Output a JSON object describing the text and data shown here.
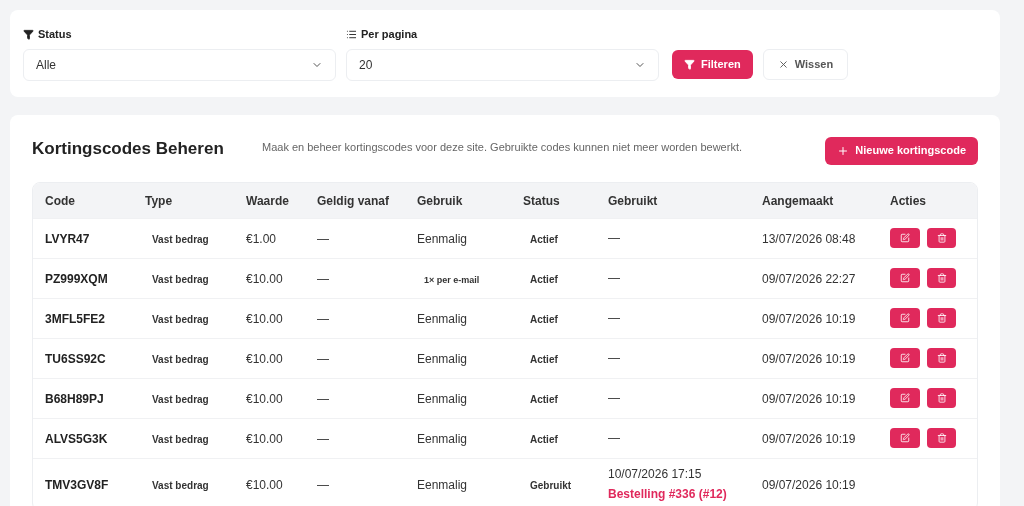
{
  "filters": {
    "status": {
      "label": "Status",
      "value": "Alle"
    },
    "per_page": {
      "label": "Per pagina",
      "value": "20"
    },
    "buttons": {
      "filter": "Filteren",
      "clear": "Wissen"
    }
  },
  "panel": {
    "title": "Kortingscodes Beheren",
    "description": "Maak en beheer kortingscodes voor deze site. Gebruikte codes kunnen niet meer worden bewerkt.",
    "new_button": "Nieuwe kortingscode"
  },
  "table": {
    "columns": [
      "Code",
      "Type",
      "Waarde",
      "Geldig vanaf",
      "Gebruik",
      "Status",
      "Gebruikt",
      "Aangemaakt",
      "Acties"
    ],
    "rows": [
      {
        "code": "LVYR47",
        "type": "Vast bedrag",
        "value": "€1.00",
        "valid_from": "—",
        "usage": "Eenmalig",
        "kind": "plain",
        "status": "Actief",
        "used": "—",
        "created": "13/07/2026 08:48",
        "editable": true
      },
      {
        "code": "PZ999XQM",
        "type": "Vast bedrag",
        "value": "€10.00",
        "valid_from": "—",
        "usage": "1× per e-mail",
        "kind": "badge",
        "status": "Actief",
        "used": "—",
        "created": "09/07/2026 22:27",
        "editable": true
      },
      {
        "code": "3MFL5FE2",
        "type": "Vast bedrag",
        "value": "€10.00",
        "valid_from": "—",
        "usage": "Eenmalig",
        "kind": "plain",
        "status": "Actief",
        "used": "—",
        "created": "09/07/2026 10:19",
        "editable": true
      },
      {
        "code": "TU6SS92C",
        "type": "Vast bedrag",
        "value": "€10.00",
        "valid_from": "—",
        "usage": "Eenmalig",
        "kind": "plain",
        "status": "Actief",
        "used": "—",
        "created": "09/07/2026 10:19",
        "editable": true
      },
      {
        "code": "B68H89PJ",
        "type": "Vast bedrag",
        "value": "€10.00",
        "valid_from": "—",
        "usage": "Eenmalig",
        "kind": "plain",
        "status": "Actief",
        "used": "—",
        "created": "09/07/2026 10:19",
        "editable": true
      },
      {
        "code": "ALVS5G3K",
        "type": "Vast bedrag",
        "value": "€10.00",
        "valid_from": "—",
        "usage": "Eenmalig",
        "kind": "plain",
        "status": "Actief",
        "used": "—",
        "created": "09/07/2026 10:19",
        "editable": true
      },
      {
        "code": "TMV3GV8F",
        "type": "Vast bedrag",
        "value": "€10.00",
        "valid_from": "—",
        "usage": "Eenmalig",
        "kind": "plain",
        "status": "Gebruikt",
        "used": "10/07/2026 17:15",
        "order": "Bestelling #336 (#12)",
        "created": "09/07/2026 10:19",
        "editable": false
      }
    ]
  }
}
